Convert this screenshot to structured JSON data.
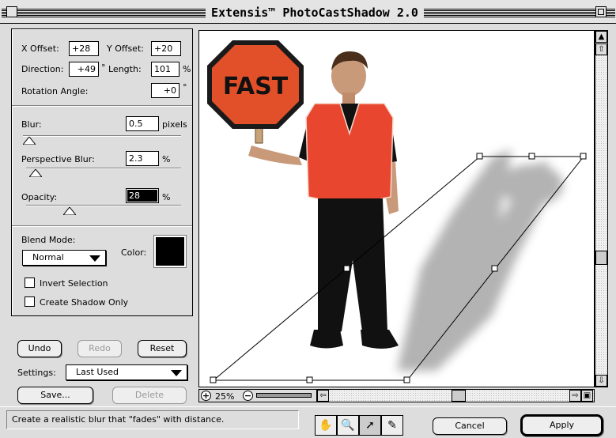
{
  "window": {
    "title": "Extensis™ PhotoCastShadow 2.0"
  },
  "offsets": {
    "x_label": "X Offset:",
    "x_value": "+28",
    "y_label": "Y Offset:",
    "y_value": "+20",
    "direction_label": "Direction:",
    "direction_value": "+49",
    "degree_symbol": "°",
    "length_label": "Length:",
    "length_value": "101",
    "percent_symbol": "%",
    "rotation_label": "Rotation Angle:",
    "rotation_value": "+0"
  },
  "blur": {
    "label": "Blur:",
    "value": "0.5",
    "unit": "pixels",
    "slider_level": 0.04
  },
  "perspective_blur": {
    "label": "Perspective Blur:",
    "value": "2.3",
    "unit": "%",
    "slider_level": 0.06
  },
  "opacity": {
    "label": "Opacity:",
    "value": "28",
    "unit": "%",
    "slider_level": 0.28
  },
  "blend": {
    "label": "Blend Mode:",
    "selected": "Normal",
    "color_label": "Color:",
    "color": "#000000"
  },
  "options": {
    "invert_label": "Invert Selection",
    "invert_checked": false,
    "shadow_only_label": "Create Shadow Only",
    "shadow_only_checked": false
  },
  "buttons": {
    "undo": "Undo",
    "redo": "Redo",
    "reset": "Reset",
    "save": "Save...",
    "delete": "Delete",
    "cancel": "Cancel",
    "apply": "Apply"
  },
  "settings": {
    "label": "Settings:",
    "selected": "Last Used"
  },
  "preview": {
    "sign_text": "FAST",
    "zoom": "25%",
    "sign_color": "#e2502a",
    "vest_color": "#e8462e"
  },
  "status": {
    "message": "Create a realistic blur that \"fades\" with distance."
  },
  "tools": [
    "hand-icon",
    "zoom-icon",
    "move-icon",
    "eyedropper-icon"
  ]
}
